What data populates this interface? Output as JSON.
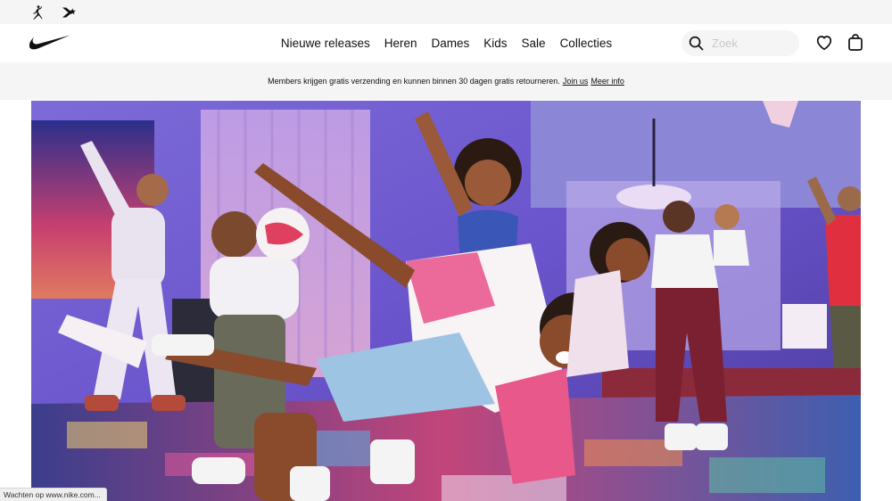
{
  "utility_bar": {
    "icons": [
      "jordan-jumpman-icon",
      "converse-star-chevron-icon"
    ]
  },
  "nav": {
    "logo": "nike-swoosh-logo",
    "menu": [
      "Nieuwe releases",
      "Heren",
      "Dames",
      "Kids",
      "Sale",
      "Collecties"
    ],
    "search": {
      "placeholder": "Zoek",
      "value": ""
    },
    "icons": [
      "search-icon",
      "heart-icon",
      "bag-icon"
    ]
  },
  "promo": {
    "text": "Members krijgen gratis verzending en kunnen binnen 30 dagen gratis retourneren.",
    "join_link": "Join us",
    "info_link": "Meer info"
  },
  "hero": {
    "image": "photo-kids-and-family-dancing-in-purple-lit-living-room"
  },
  "status_bar": {
    "text": "Wachten op www.nike.com..."
  },
  "colors": {
    "background": "#ffffff",
    "utility_bar": "#f5f5f5",
    "promo_bar": "#f5f5f5",
    "text": "#111111",
    "hero_purple": "#6a4fd0",
    "hero_pink": "#f07aa0"
  }
}
